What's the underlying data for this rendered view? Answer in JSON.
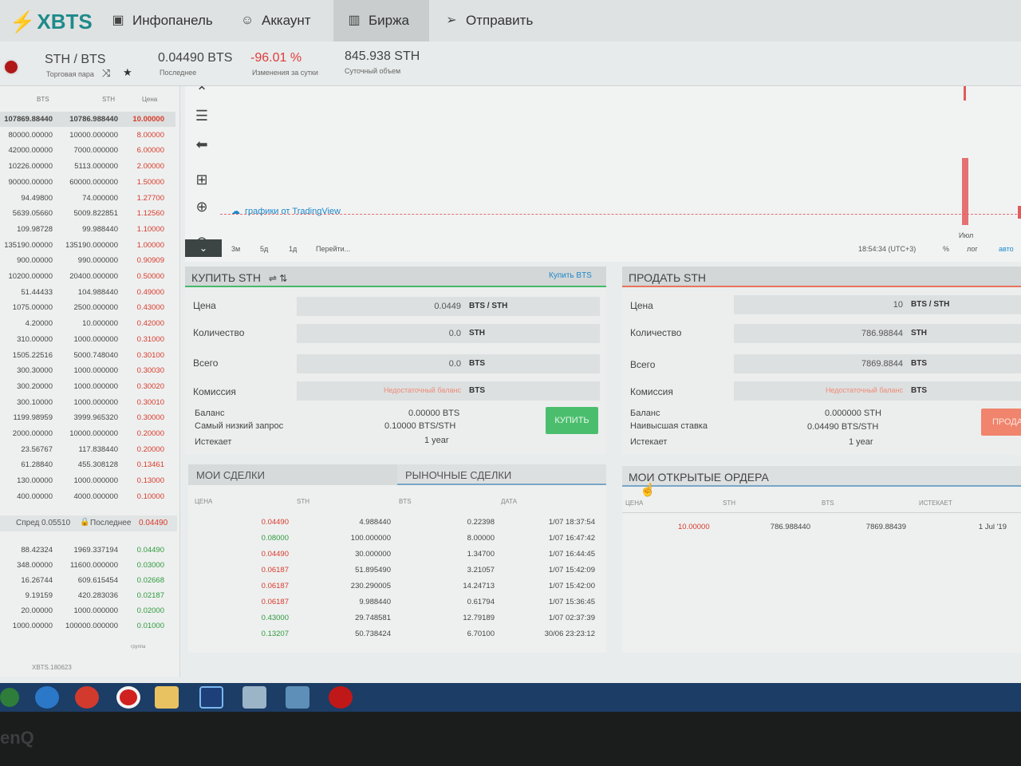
{
  "brand": {
    "logo": "XBTS"
  },
  "nav": {
    "tabs": [
      {
        "label": "Инфопанель",
        "icon": "dashboard-icon"
      },
      {
        "label": "Аккаунт",
        "icon": "user-icon"
      },
      {
        "label": "Биржа",
        "icon": "exchange-icon",
        "active": true
      },
      {
        "label": "Отправить",
        "icon": "send-icon"
      }
    ]
  },
  "ticker": {
    "pair": "STH / BTS",
    "pair_caption": "Торговая пара",
    "last": "0.04490 BTS",
    "last_caption": "Последнее",
    "change": "-96.01 %",
    "change_caption": "Изменения за сутки",
    "volume": "845.938 STH",
    "volume_caption": "Суточный объем"
  },
  "orderbook": {
    "headers": [
      "BTS",
      "STH",
      "Цена"
    ],
    "asks": [
      [
        "107869.88440",
        "10786.988440",
        "10.00000"
      ],
      [
        "80000.00000",
        "10000.000000",
        "8.00000"
      ],
      [
        "42000.00000",
        "7000.000000",
        "6.00000"
      ],
      [
        "10226.00000",
        "5113.000000",
        "2.00000"
      ],
      [
        "90000.00000",
        "60000.000000",
        "1.50000"
      ],
      [
        "94.49800",
        "74.000000",
        "1.27700"
      ],
      [
        "5639.05660",
        "5009.822851",
        "1.12560"
      ],
      [
        "109.98728",
        "99.988440",
        "1.10000"
      ],
      [
        "135190.00000",
        "135190.000000",
        "1.00000"
      ],
      [
        "900.00000",
        "990.000000",
        "0.90909"
      ],
      [
        "10200.00000",
        "20400.000000",
        "0.50000"
      ],
      [
        "51.44433",
        "104.988440",
        "0.49000"
      ],
      [
        "1075.00000",
        "2500.000000",
        "0.43000"
      ],
      [
        "4.20000",
        "10.000000",
        "0.42000"
      ],
      [
        "310.00000",
        "1000.000000",
        "0.31000"
      ],
      [
        "1505.22516",
        "5000.748040",
        "0.30100"
      ],
      [
        "300.30000",
        "1000.000000",
        "0.30030"
      ],
      [
        "300.20000",
        "1000.000000",
        "0.30020"
      ],
      [
        "300.10000",
        "1000.000000",
        "0.30010"
      ],
      [
        "1199.98959",
        "3999.965320",
        "0.30000"
      ],
      [
        "2000.00000",
        "10000.000000",
        "0.20000"
      ],
      [
        "23.56767",
        "117.838440",
        "0.20000"
      ],
      [
        "61.28840",
        "455.308128",
        "0.13461"
      ],
      [
        "130.00000",
        "1000.000000",
        "0.13000"
      ],
      [
        "400.00000",
        "4000.000000",
        "0.10000"
      ]
    ],
    "spread_label": "Спред",
    "spread_value": "0.05510",
    "last_label": "Последнее",
    "last_value": "0.04490",
    "bids": [
      [
        "88.42324",
        "1969.337194",
        "0.04490"
      ],
      [
        "348.00000",
        "11600.000000",
        "0.03000"
      ],
      [
        "16.26744",
        "609.615454",
        "0.02668"
      ],
      [
        "9.19159",
        "420.283036",
        "0.02187"
      ],
      [
        "20.00000",
        "1000.000000",
        "0.02000"
      ],
      [
        "1000.00000",
        "100000.000000",
        "0.01000"
      ]
    ],
    "group_label": "группа",
    "version": "XBTS.180623"
  },
  "chart": {
    "tradingview_label": "графики от TradingView",
    "month_label": "Июл",
    "ranges": [
      "3м",
      "5д",
      "1д",
      "Перейти..."
    ],
    "clock": "18:54:34 (UTC+3)",
    "percent_label": "%",
    "log_label": "лог",
    "auto_label": "авто"
  },
  "buy": {
    "title": "КУПИТЬ STH",
    "link": "Купить BTS",
    "price_label": "Цена",
    "price_value": "0.0449",
    "price_unit": "BTS / STH",
    "qty_label": "Количество",
    "qty_value": "0.0",
    "qty_unit": "STH",
    "total_label": "Всего",
    "total_value": "0.0",
    "total_unit": "BTS",
    "fee_label": "Комиссия",
    "fee_value": "Недостаточный баланс",
    "fee_unit": "BTS",
    "balance_label": "Баланс",
    "balance_value": "0.00000 BTS",
    "lowest_ask_label": "Самый низкий запрос",
    "lowest_ask_value": "0.10000 BTS/STH",
    "expires_label": "Истекает",
    "expires_value": "1 year",
    "button": "КУПИТЬ"
  },
  "sell": {
    "title": "ПРОДАТЬ STH",
    "price_label": "Цена",
    "price_value": "10",
    "price_unit": "BTS / STH",
    "qty_label": "Количество",
    "qty_value": "786.98844",
    "qty_unit": "STH",
    "total_label": "Всего",
    "total_value": "7869.8844",
    "total_unit": "BTS",
    "fee_label": "Комиссия",
    "fee_value": "Недостаточный баланс",
    "fee_unit": "BTS",
    "balance_label": "Баланс",
    "balance_value": "0.000000 STH",
    "highest_bid_label": "Наивысшая ставка",
    "highest_bid_value": "0.04490 BTS/STH",
    "expires_label": "Истекает",
    "expires_value": "1 year",
    "button": "ПРОДА"
  },
  "trades": {
    "tab_mine": "МОИ СДЕЛКИ",
    "tab_market": "РЫНОЧНЫЕ СДЕЛКИ",
    "headers": [
      "ЦЕНА",
      "STH",
      "BTS",
      "ДАТА"
    ],
    "rows": [
      {
        "price": "0.04490",
        "dir": "sell",
        "sth": "4.988440",
        "bts": "0.22398",
        "date": "1/07 18:37:54"
      },
      {
        "price": "0.08000",
        "dir": "buy",
        "sth": "100.000000",
        "bts": "8.00000",
        "date": "1/07 16:47:42"
      },
      {
        "price": "0.04490",
        "dir": "sell",
        "sth": "30.000000",
        "bts": "1.34700",
        "date": "1/07 16:44:45"
      },
      {
        "price": "0.06187",
        "dir": "sell",
        "sth": "51.895490",
        "bts": "3.21057",
        "date": "1/07 15:42:09"
      },
      {
        "price": "0.06187",
        "dir": "sell",
        "sth": "230.290005",
        "bts": "14.24713",
        "date": "1/07 15:42:00"
      },
      {
        "price": "0.06187",
        "dir": "sell",
        "sth": "9.988440",
        "bts": "0.61794",
        "date": "1/07 15:36:45"
      },
      {
        "price": "0.43000",
        "dir": "buy",
        "sth": "29.748581",
        "bts": "12.79189",
        "date": "1/07 02:37:39"
      },
      {
        "price": "0.13207",
        "dir": "buy",
        "sth": "50.738424",
        "bts": "6.70100",
        "date": "30/06 23:23:12"
      }
    ]
  },
  "open_orders": {
    "title": "МОИ ОТКРЫТЫЕ ОРДЕРА",
    "headers": [
      "ЦЕНА",
      "STH",
      "BTS",
      "ИСТЕКАЕТ"
    ],
    "rows": [
      {
        "price": "10.00000",
        "sth": "786.988440",
        "bts": "7869.88439",
        "expires": "1 Jul '19"
      }
    ]
  },
  "monitor_brand": "enQ",
  "colors": {
    "accent": "#1f8a8a",
    "ask": "#d83a2a",
    "bid": "#2f9a3c",
    "buy_button": "#4bbe6e",
    "sell_button": "#f0846c",
    "taskbar": "#1c3d66"
  }
}
